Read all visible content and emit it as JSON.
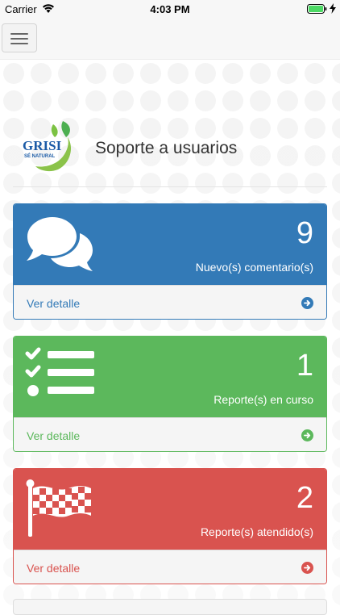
{
  "status_bar": {
    "carrier": "Carrier",
    "time": "4:03 PM"
  },
  "navbar": {
    "menu_icon": "hamburger-menu-icon"
  },
  "header": {
    "logo_text": "GRISI",
    "logo_tagline": "SÉ NATURAL",
    "title": "Soporte a usuarios"
  },
  "panels": [
    {
      "icon": "comments-icon",
      "count": "9",
      "label": "Nuevo(s) comentario(s)",
      "link": "Ver detalle",
      "color": "#337ab7"
    },
    {
      "icon": "tasks-list-icon",
      "count": "1",
      "label": "Reporte(s) en curso",
      "link": "Ver detalle",
      "color": "#5cb85c"
    },
    {
      "icon": "checkered-flag-icon",
      "count": "2",
      "label": "Reporte(s) atendido(s)",
      "link": "Ver detalle",
      "color": "#d9534f"
    }
  ]
}
